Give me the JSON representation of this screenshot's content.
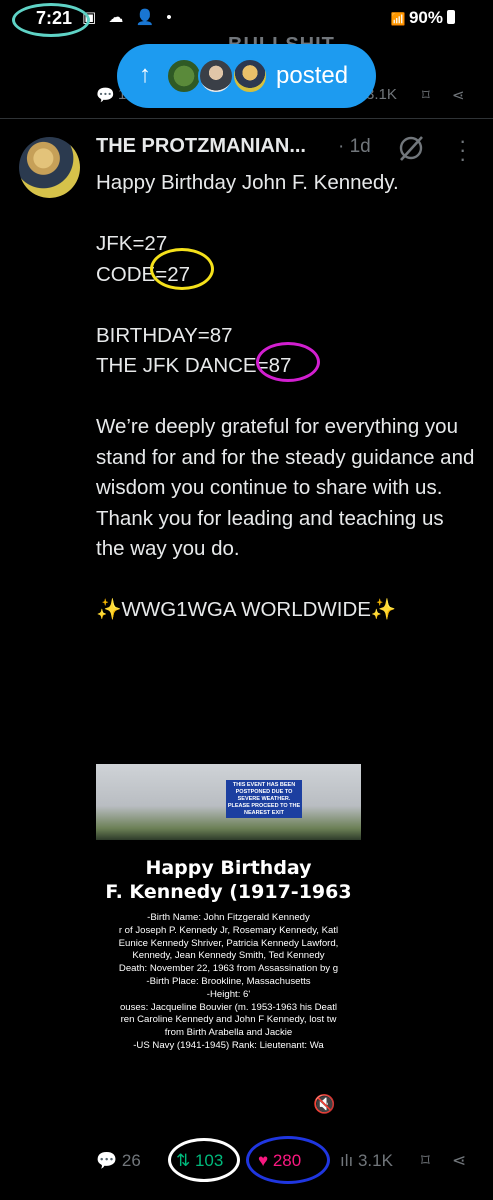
{
  "status_bar": {
    "time": "7:21",
    "icons": "▣ ☁ 👤 •",
    "signal": "📶",
    "battery": "90%"
  },
  "previous_post": {
    "title_fragment": "BULLSHIT",
    "replies_prefix": "1",
    "views": "3.1K"
  },
  "posted_pill": {
    "label": "posted",
    "arrow": "↑"
  },
  "tweet": {
    "author": "THE PROTZMANIAN...",
    "time": "· 1d",
    "lines": [
      "Happy Birthday John F. Kennedy.",
      "",
      "JFK=27",
      "CODE=27",
      "",
      "BIRTHDAY=87",
      "THE JFK DANCE=87",
      "",
      "We’re deeply grateful for everything you stand for and for the steady guidance and wisdom you continue to share with us. Thank you for leading and teaching us the way you do.",
      "",
      "✨WWG1WGA WORLDWIDE✨"
    ],
    "media": {
      "sign_text": "THIS EVENT HAS BEEN POSTPONED DUE TO SEVERE WEATHER. PLEASE PROCEED TO THE NEAREST EXIT",
      "title_line1": "Happy Birthday",
      "title_line2": "F. Kennedy (1917-1963",
      "lines": [
        "-Birth Name: John Fitzgerald Kennedy",
        "r of Joseph P. Kennedy Jr, Rosemary Kennedy, Katl",
        "Eunice Kennedy Shriver, Patricia Kennedy Lawford,",
        "Kennedy, Jean Kennedy Smith, Ted Kennedy",
        "Death: November 22, 1963 from Assassination by g",
        "-Birth Place: Brookline, Massachusetts",
        "-Height: 6'",
        "ouses: Jacqueline Bouvier (m. 1953-1963 his Deatl",
        "ren Caroline Kennedy and John F Kennedy, lost tw",
        "from Birth Arabella and Jackie",
        "-US Navy (1941-1945) Rank: Lieutenant: Wa"
      ],
      "mute_icon": "🔇"
    },
    "actions": {
      "replies": "26",
      "reposts": "103",
      "likes": "280",
      "views": "3.1K"
    }
  },
  "colors": {
    "accent": "#1d9bf0",
    "repost": "#00ba7c",
    "like": "#f91880",
    "annot_cyan": "#5fd3c6",
    "annot_yellow": "#f5e11b",
    "annot_magenta": "#d21fd0",
    "annot_blue": "#1f36e0"
  }
}
